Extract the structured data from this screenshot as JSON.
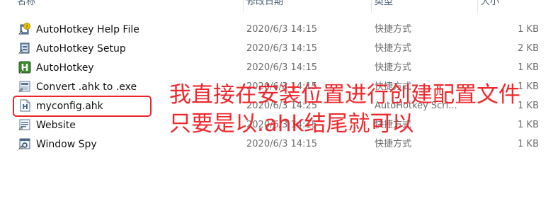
{
  "columns": {
    "name": "名称",
    "date": "修改日期",
    "type": "类型",
    "size": "大小"
  },
  "files": [
    {
      "name": "AutoHotkey Help File",
      "date": "2020/6/3 14:15",
      "type": "快捷方式",
      "size": "1 KB",
      "icon": "help-file-icon"
    },
    {
      "name": "AutoHotkey Setup",
      "date": "2020/6/3 14:15",
      "type": "快捷方式",
      "size": "2 KB",
      "icon": "setup-icon"
    },
    {
      "name": "AutoHotkey",
      "date": "2020/6/3 14:15",
      "type": "快捷方式",
      "size": "1 KB",
      "icon": "autohotkey-icon"
    },
    {
      "name": "Convert .ahk to .exe",
      "date": "2020/6/3 14:15",
      "type": "快捷方式",
      "size": "1 KB",
      "icon": "convert-icon"
    },
    {
      "name": "myconfig.ahk",
      "date": "2020/6/3 14:25",
      "type": "AutoHotkey Scri...",
      "size": "1 KB",
      "icon": "ahk-script-icon"
    },
    {
      "name": "Website",
      "date": "2020/6/3 14:15",
      "type": "快捷方式",
      "size": "1 KB",
      "icon": "website-icon"
    },
    {
      "name": "Window Spy",
      "date": "2020/6/3 14:15",
      "type": "快捷方式",
      "size": "1 KB",
      "icon": "window-spy-icon"
    }
  ],
  "annotation": {
    "line1": "我直接在安装位置进行创建配置文件",
    "line2": "只要是以.ahk结尾就可以",
    "color": "#f0282c"
  }
}
